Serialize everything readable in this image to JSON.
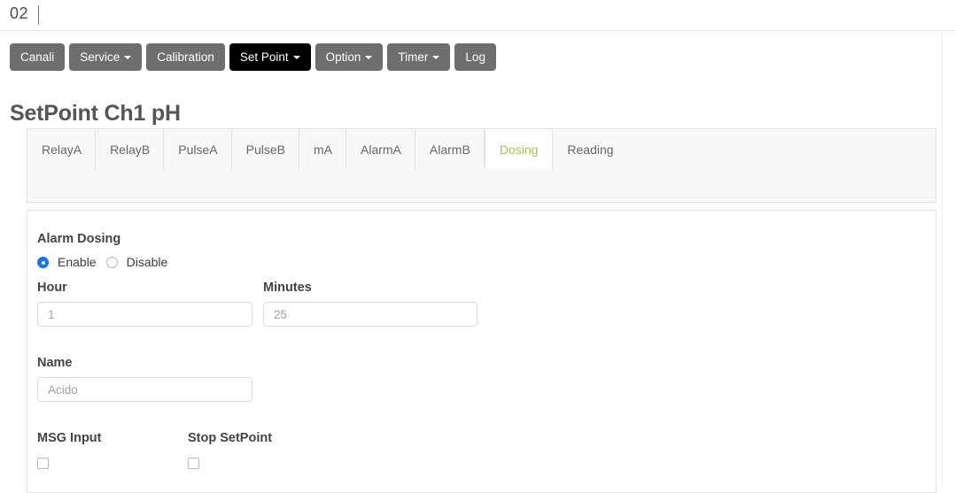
{
  "topbar": {
    "text": "02",
    "cursor": "|"
  },
  "navbar": {
    "buttons": [
      {
        "label": "Canali",
        "caret": false,
        "active": false
      },
      {
        "label": "Service",
        "caret": true,
        "active": false
      },
      {
        "label": "Calibration",
        "caret": false,
        "active": false
      },
      {
        "label": "Set Point",
        "caret": true,
        "active": true
      },
      {
        "label": "Option",
        "caret": true,
        "active": false
      },
      {
        "label": "Timer",
        "caret": true,
        "active": false
      },
      {
        "label": "Log",
        "caret": false,
        "active": false
      }
    ]
  },
  "page": {
    "title": "SetPoint Ch1 pH"
  },
  "tabs": {
    "active_color": "#b3c043",
    "items": [
      {
        "label": "RelayA",
        "active": false
      },
      {
        "label": "RelayB",
        "active": false
      },
      {
        "label": "PulseA",
        "active": false
      },
      {
        "label": "PulseB",
        "active": false
      },
      {
        "label": "mA",
        "active": false
      },
      {
        "label": "AlarmA",
        "active": false
      },
      {
        "label": "AlarmB",
        "active": false
      },
      {
        "label": "Dosing",
        "active": true
      },
      {
        "label": "Reading",
        "active": false
      }
    ]
  },
  "form": {
    "alarm_dosing": {
      "title": "Alarm Dosing",
      "enable_label": "Enable",
      "disable_label": "Disable",
      "selected": "Enable",
      "accent_color": "#1a73e8"
    },
    "hour": {
      "label": "Hour",
      "value": "",
      "placeholder": "1"
    },
    "minutes": {
      "label": "Minutes",
      "value": "",
      "placeholder": "25"
    },
    "name": {
      "label": "Name",
      "value": "",
      "placeholder": "Acido"
    },
    "msg_input": {
      "label": "MSG Input",
      "checked": false
    },
    "stop_setpoint": {
      "label": "Stop SetPoint",
      "checked": false
    }
  }
}
